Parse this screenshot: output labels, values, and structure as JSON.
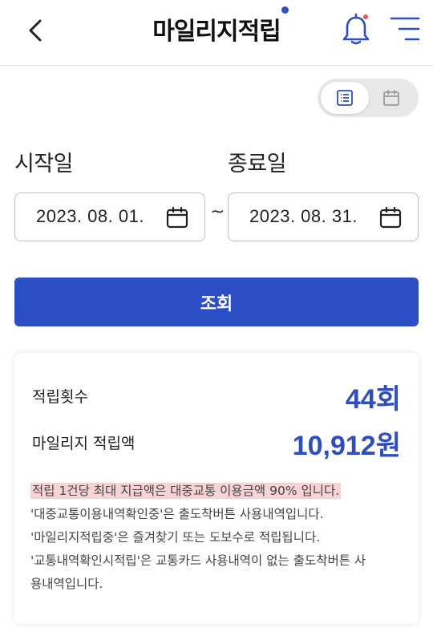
{
  "header": {
    "title": "마일리지적립"
  },
  "date_range": {
    "start_label": "시작일",
    "start_value": "2023. 08. 01.",
    "separator": "~",
    "end_label": "종료일",
    "end_value": "2023. 08. 31."
  },
  "search_button": "조회",
  "summary": {
    "count_label": "적립횟수",
    "count_value": "44회",
    "amount_label": "마일리지 적립액",
    "amount_value": "10,912원"
  },
  "notes": [
    "적립 1건당 최대 지급액은 대중교통 이용금액 90% 입니다.",
    "'대중교통이용내역확인중'은 출도착버튼 사용내역입니다.",
    "'마일리지적립중'은 즐겨찾기 또는 도보수로 적립됩니다.",
    "'교통내역확인시적립'은 교통카드 사용내역이 없는 출도착버튼 사",
    "용내역입니다."
  ],
  "colors": {
    "accent": "#2c4ec5",
    "highlight": "#f8d3d3",
    "notification_dot": "#e05a5a"
  },
  "icons": {
    "back": "chevron-left-icon",
    "bell": "bell-icon",
    "menu": "menu-icon",
    "list_view": "list-icon",
    "calendar_view": "calendar-icon"
  }
}
